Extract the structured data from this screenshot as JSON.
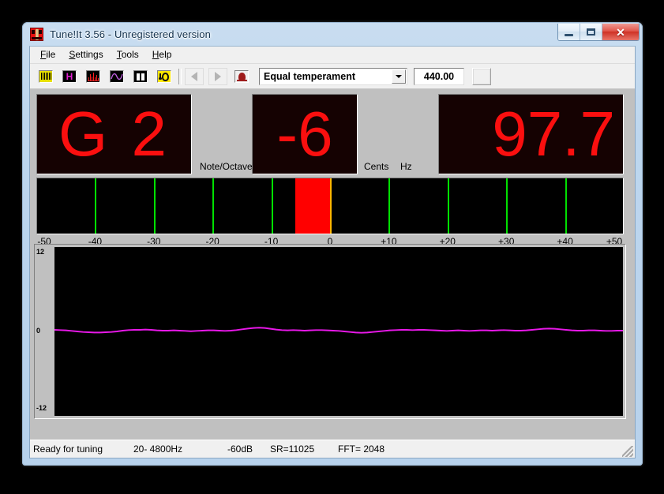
{
  "window": {
    "title": "Tune!It 3.56  -  Unregistered version",
    "app_icon": "tuning-fork-icon",
    "buttons": {
      "minimize": "minimize-icon",
      "maximize": "maximize-icon",
      "close": "✕"
    }
  },
  "menu": {
    "items": [
      {
        "label": "File",
        "accel": "F"
      },
      {
        "label": "Settings",
        "accel": "S"
      },
      {
        "label": "Tools",
        "accel": "T"
      },
      {
        "label": "Help",
        "accel": "H"
      }
    ]
  },
  "toolbar": {
    "buttons": [
      {
        "name": "keyboard-view-button",
        "icon": "piano-keyboard-icon"
      },
      {
        "name": "harmonics-view-button",
        "icon": "letter-h-icon",
        "glyph": "H"
      },
      {
        "name": "spectrum-view-button",
        "icon": "spectrum-bars-icon"
      },
      {
        "name": "waveform-view-button",
        "icon": "sine-wave-icon"
      },
      {
        "name": "meter-view-button",
        "icon": "two-bars-icon"
      },
      {
        "name": "listen-button",
        "icon": "ear-note-icon"
      },
      {
        "name": "previous-button",
        "icon": "triangle-left-icon"
      },
      {
        "name": "next-button",
        "icon": "triangle-right-icon"
      },
      {
        "name": "about-button",
        "icon": "red-head-icon"
      }
    ],
    "temperament": {
      "value": "Equal temperament",
      "arrow": "chevron-down-icon"
    },
    "reference_pitch": "440.00",
    "extra_button": "blank-button"
  },
  "displays": {
    "note": "G 2",
    "note_label": "Note/Octave",
    "cents": "-6",
    "cents_label": "Cents",
    "hz": "97.7",
    "hz_label": "Hz",
    "led_color": "#fa0f0f",
    "led_background": "#150202"
  },
  "meter": {
    "min": -50,
    "max": 50,
    "value": -6,
    "zero_line_color": "#ffb400",
    "bar_color": "#ff0000",
    "tick_color": "#00e000",
    "ticks": [
      -40,
      -30,
      -20,
      -10,
      10,
      20,
      30,
      40
    ],
    "scale_labels": [
      "-50",
      "-40",
      "-30",
      "-20",
      "-10",
      "0",
      "+10",
      "+20",
      "+30",
      "+40",
      "+50"
    ],
    "scale_values": [
      -50,
      -40,
      -30,
      -20,
      -10,
      0,
      10,
      20,
      30,
      40,
      50
    ]
  },
  "waveform": {
    "y_top": "12",
    "y_mid": "0",
    "y_bottom": "-12",
    "trace_color": "#e818e8",
    "background": "#000000",
    "samples": [
      0.06,
      0.05,
      0.04,
      0.02,
      0.0,
      -0.02,
      -0.03,
      -0.04,
      -0.04,
      -0.03,
      -0.02,
      0.0,
      0.03,
      0.05,
      0.06,
      0.06,
      0.07,
      0.06,
      0.04,
      0.03,
      0.03,
      0.04,
      0.03,
      0.02,
      0.01,
      0.02,
      0.03,
      0.04,
      0.04,
      0.03,
      0.02,
      0.03,
      0.05,
      0.08,
      0.11,
      0.13,
      0.14,
      0.13,
      0.1,
      0.07,
      0.05,
      0.04,
      0.05,
      0.04,
      0.03,
      0.04,
      0.05,
      0.05,
      0.04,
      0.03,
      0.02,
      0.0,
      -0.02,
      -0.04,
      -0.05,
      -0.04,
      -0.02,
      0.0,
      0.02,
      0.04,
      0.05,
      0.06,
      0.06,
      0.05,
      0.06,
      0.06,
      0.05,
      0.04,
      0.03,
      0.02,
      0.03,
      0.04,
      0.03,
      0.02,
      0.03,
      0.04,
      0.04,
      0.03,
      0.04,
      0.05,
      0.04,
      0.03,
      0.03,
      0.04,
      0.06,
      0.08,
      0.1,
      0.11,
      0.1,
      0.08,
      0.06,
      0.04,
      0.03,
      0.03,
      0.04,
      0.04,
      0.03,
      0.02,
      0.02,
      0.03,
      0.03
    ]
  },
  "statusbar": {
    "ready": "Ready for tuning",
    "range": "20- 4800Hz",
    "threshold": "-60dB",
    "sample_rate": "SR=11025",
    "fft": "FFT= 2048",
    "grip": "resize-grip-icon"
  }
}
